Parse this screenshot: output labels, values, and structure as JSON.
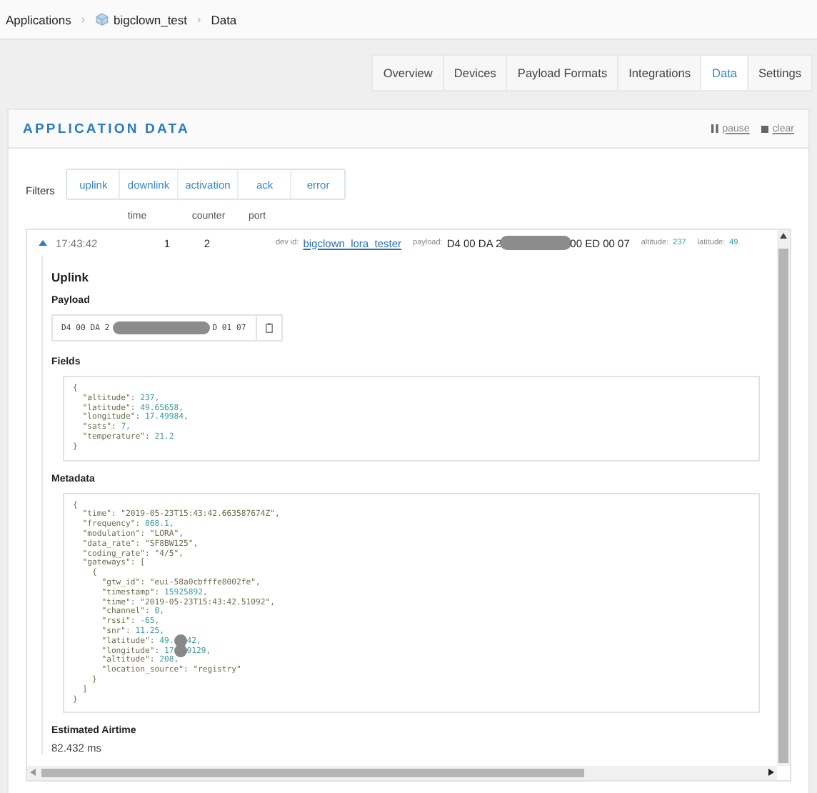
{
  "breadcrumb": [
    {
      "label": "Applications",
      "kind": "plain"
    },
    {
      "separator": "›",
      "label": "bigclown_test",
      "kind": "application"
    },
    {
      "separator": "›",
      "label": "Data",
      "kind": "plain"
    }
  ],
  "tabs": [
    {
      "label": "Overview",
      "selected": false
    },
    {
      "label": "Devices",
      "selected": false
    },
    {
      "label": "Payload Formats",
      "selected": false
    },
    {
      "label": "Integrations",
      "selected": false
    },
    {
      "label": "Data",
      "selected": true
    },
    {
      "label": "Settings",
      "selected": false
    }
  ],
  "panel": {
    "title": "APPLICATION DATA",
    "actions": [
      {
        "kind": "pause",
        "label": "pause"
      },
      {
        "kind": "clear",
        "label": "clear"
      }
    ]
  },
  "filters": {
    "label": "Filters",
    "items": [
      "uplink",
      "downlink",
      "activation",
      "ack",
      "error"
    ]
  },
  "table": {
    "columns": [
      "time",
      "counter",
      "port"
    ],
    "event": {
      "expanded": true,
      "time": "17:43:42",
      "counter": "1",
      "port": "2",
      "dev_id_label": "dev id:",
      "dev_id": "bigclown_lora_tester",
      "payload_label": "payload:",
      "payload_start": "D4 00 DA 2",
      "payload_end": "00 ED 00 07",
      "fields": [
        {
          "label": "altitude:",
          "value": "237"
        },
        {
          "label": "latitude:",
          "value": "49."
        }
      ]
    }
  },
  "detail": {
    "title": "Uplink",
    "payload_heading": "Payload",
    "payload_start": "D4 00 DA 2",
    "payload_end": "D 01 07",
    "fields_heading": "Fields",
    "fields": [
      {
        "text": "{"
      },
      {
        "text": "  \"altitude\": ",
        "value": "237,"
      },
      {
        "text": "  \"latitude\": ",
        "value": "49.65658,"
      },
      {
        "text": "  \"longitude\": ",
        "value": "17.49984,"
      },
      {
        "text": "  \"sats\": ",
        "value": "7,"
      },
      {
        "text": "  \"temperature\": ",
        "value": "21.2"
      },
      {
        "text": "}"
      }
    ],
    "metadata_heading": "Metadata",
    "metadata": [
      {
        "text": "{"
      },
      {
        "text": "  \"time\": \"2019-05-23T15:43:42.663587674Z\","
      },
      {
        "text": "  \"frequency\": ",
        "value": "868.1,"
      },
      {
        "text": "  \"modulation\": \"LORA\","
      },
      {
        "text": "  \"data_rate\": \"SF8BW125\","
      },
      {
        "text": "  \"coding_rate\": \"4/5\","
      },
      {
        "text": "  \"gateways\": ["
      },
      {
        "text": "    {"
      },
      {
        "text": "      \"gtw_id\": \"eui-58a0cbfffe8002fe\","
      },
      {
        "text": "      \"timestamp\": ",
        "value": "15925892,"
      },
      {
        "text": "      \"time\": \"2019-05-23T15:43:42.51092\","
      },
      {
        "text": "      \"channel\": ",
        "value": "0,"
      },
      {
        "text": "      \"rssi\": ",
        "value": "-65,"
      },
      {
        "text": "      \"snr\": ",
        "value": "11.25,"
      },
      {
        "text": "      \"latitude\": ",
        "value": "49.",
        "redacted": true,
        "value_end": "42,"
      },
      {
        "text": "      \"longitude\": ",
        "value": "17",
        "redacted": true,
        "value_end": "0129,"
      },
      {
        "text": "      \"altitude\": ",
        "value": "208,"
      },
      {
        "text": "      \"location_source\": \"registry\""
      },
      {
        "text": "    }"
      },
      {
        "text": "  ]"
      },
      {
        "text": "}"
      }
    ],
    "airtime_heading": "Estimated Airtime",
    "airtime": "82.432 ms"
  }
}
